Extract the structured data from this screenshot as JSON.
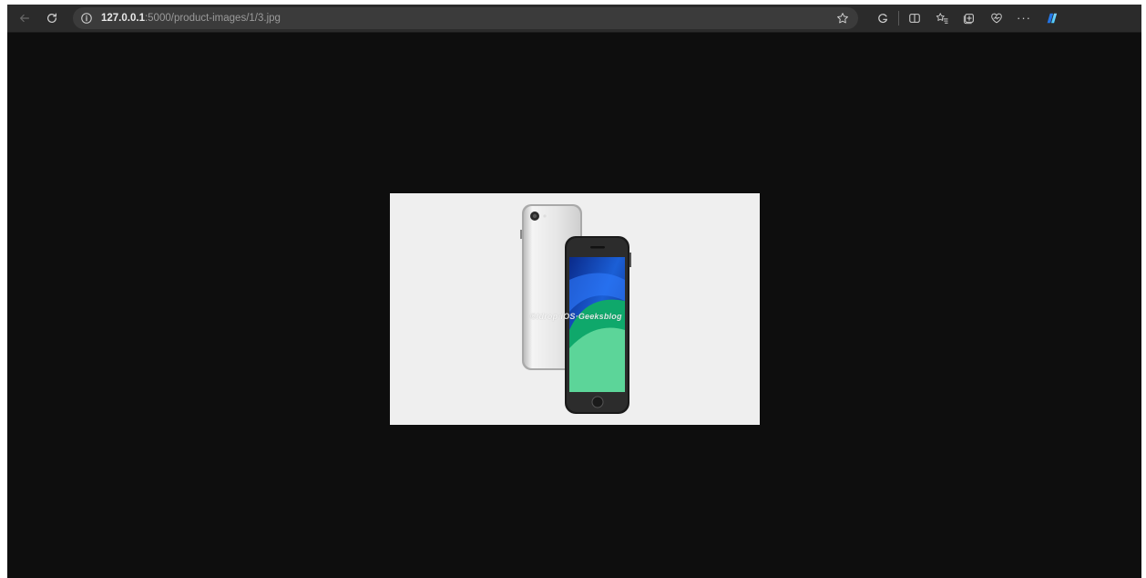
{
  "browser": {
    "url_host": "127.0.0.1",
    "url_path": ":5000/product-images/1/3.jpg"
  },
  "toolbar_icons": {
    "back": "back-arrow-icon",
    "refresh": "refresh-icon",
    "site_info": "info-icon",
    "favorite": "star-icon",
    "copilot_small": "copilot-icon",
    "split_screen": "split-screen-icon",
    "favorites_list": "favorites-icon",
    "collections": "collections-icon",
    "extensions": "heart-pulse-icon",
    "more": "ellipsis-icon",
    "copilot": "copilot-logo-icon"
  },
  "image": {
    "watermark": "©Idrop·iOS·Geeksblog",
    "background_color": "#efefef"
  },
  "colors": {
    "page_bg": "#0e0e0e",
    "toolbar_bg": "#2b2b2b",
    "address_bg": "#3b3b3b",
    "accent_blue": "#1a73e8"
  }
}
